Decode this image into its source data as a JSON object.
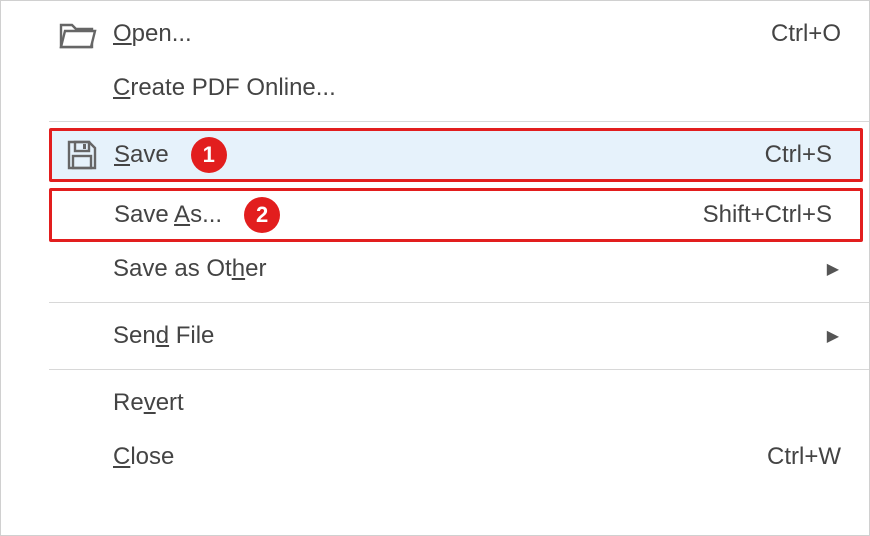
{
  "menu": {
    "open": {
      "label": "Open...",
      "shortcut": "Ctrl+O"
    },
    "createPdf": {
      "label": "Create PDF Online..."
    },
    "save": {
      "label": "Save",
      "shortcut": "Ctrl+S"
    },
    "saveAs": {
      "label": "Save As...",
      "shortcut": "Shift+Ctrl+S"
    },
    "saveAsOther": {
      "label": "Save as Other"
    },
    "sendFile": {
      "label": "Send File"
    },
    "revert": {
      "label": "Revert"
    },
    "close": {
      "label": "Close",
      "shortcut": "Ctrl+W"
    }
  },
  "callouts": {
    "save": "1",
    "saveAs": "2"
  },
  "colors": {
    "highlightBg": "#e6f2fb",
    "annotation": "#e21e1e",
    "separator": "#d8d8d8",
    "text": "#444444"
  }
}
